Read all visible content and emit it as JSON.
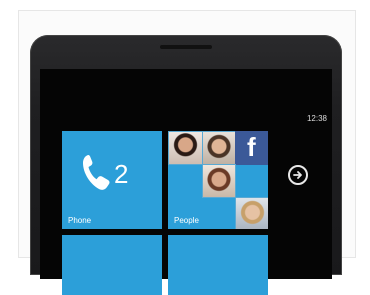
{
  "status_bar": {
    "time": "12:38"
  },
  "tiles": {
    "phone": {
      "label": "Phone",
      "count": "2",
      "icon": "phone-handset-icon"
    },
    "people": {
      "label": "People",
      "facebook_icon": "facebook-icon"
    }
  },
  "navigation": {
    "arrow_icon": "arrow-right-circle-icon"
  },
  "colors": {
    "tile_accent": "#2c9fd9",
    "screen_background": "#050505",
    "phone_body": "#1f1f21",
    "facebook_blue": "#3b5998"
  }
}
